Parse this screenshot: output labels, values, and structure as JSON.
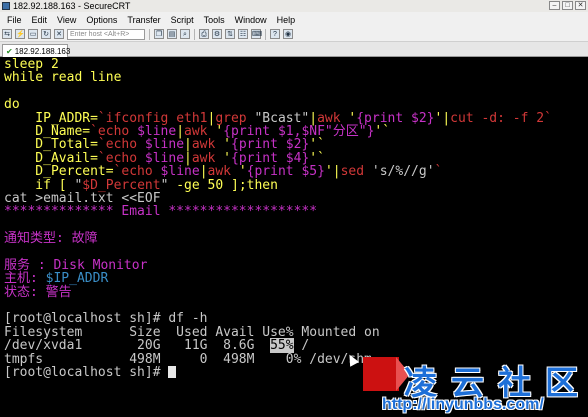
{
  "window": {
    "title": "182.92.188.163 - SecureCRT",
    "controls": [
      "–",
      "□",
      "✕"
    ]
  },
  "menu": [
    "File",
    "Edit",
    "View",
    "Options",
    "Transfer",
    "Script",
    "Tools",
    "Window",
    "Help"
  ],
  "toolbar": {
    "host_placeholder": "Enter host <Alt+R>"
  },
  "tab": {
    "label": "182.92.188.163"
  },
  "terminal": {
    "lines": [
      [
        {
          "t": "sleep 2",
          "c": "y"
        }
      ],
      [
        {
          "t": "while read line",
          "c": "y"
        }
      ],
      [
        {
          "t": "",
          "c": "y"
        }
      ],
      [
        {
          "t": "do",
          "c": "y"
        }
      ],
      [
        {
          "t": "    IP_ADDR=",
          "c": "y"
        },
        {
          "t": "`",
          "c": "r"
        },
        {
          "t": "ifconfig eth1",
          "c": "r"
        },
        {
          "t": "|",
          "c": "y"
        },
        {
          "t": "grep ",
          "c": "r"
        },
        {
          "t": "\"Bcast\"",
          "c": "w"
        },
        {
          "t": "|",
          "c": "y"
        },
        {
          "t": "awk ",
          "c": "r"
        },
        {
          "t": "'",
          "c": "y"
        },
        {
          "t": "{print $2}",
          "c": "m"
        },
        {
          "t": "'",
          "c": "y"
        },
        {
          "t": "|",
          "c": "y"
        },
        {
          "t": "cut -d: -f 2`",
          "c": "r"
        }
      ],
      [
        {
          "t": "    D_Name=",
          "c": "y"
        },
        {
          "t": "`",
          "c": "r"
        },
        {
          "t": "echo ",
          "c": "r"
        },
        {
          "t": "$line",
          "c": "m"
        },
        {
          "t": "|",
          "c": "y"
        },
        {
          "t": "awk ",
          "c": "r"
        },
        {
          "t": "'",
          "c": "y"
        },
        {
          "t": "{print $1,$NF\"分区\"}",
          "c": "m"
        },
        {
          "t": "'`",
          "c": "y"
        }
      ],
      [
        {
          "t": "    D_Total=",
          "c": "y"
        },
        {
          "t": "`",
          "c": "r"
        },
        {
          "t": "echo ",
          "c": "r"
        },
        {
          "t": "$line",
          "c": "m"
        },
        {
          "t": "|",
          "c": "y"
        },
        {
          "t": "awk ",
          "c": "r"
        },
        {
          "t": "'",
          "c": "y"
        },
        {
          "t": "{print $2}",
          "c": "m"
        },
        {
          "t": "'`",
          "c": "y"
        }
      ],
      [
        {
          "t": "    D_Avail=",
          "c": "y"
        },
        {
          "t": "`",
          "c": "r"
        },
        {
          "t": "echo ",
          "c": "r"
        },
        {
          "t": "$line",
          "c": "m"
        },
        {
          "t": "|",
          "c": "y"
        },
        {
          "t": "awk ",
          "c": "r"
        },
        {
          "t": "'",
          "c": "y"
        },
        {
          "t": "{print $4}",
          "c": "m"
        },
        {
          "t": "'`",
          "c": "y"
        }
      ],
      [
        {
          "t": "    D_Percent=",
          "c": "y"
        },
        {
          "t": "`",
          "c": "r"
        },
        {
          "t": "echo ",
          "c": "r"
        },
        {
          "t": "$line",
          "c": "m"
        },
        {
          "t": "|",
          "c": "y"
        },
        {
          "t": "awk ",
          "c": "r"
        },
        {
          "t": "'",
          "c": "y"
        },
        {
          "t": "{print $5}",
          "c": "m"
        },
        {
          "t": "'",
          "c": "y"
        },
        {
          "t": "|",
          "c": "y"
        },
        {
          "t": "sed ",
          "c": "r"
        },
        {
          "t": "'s/%//g'",
          "c": "w"
        },
        {
          "t": "`",
          "c": "r"
        }
      ],
      [
        {
          "t": "    if [ ",
          "c": "y"
        },
        {
          "t": "\"",
          "c": "w"
        },
        {
          "t": "$D_Percent",
          "c": "r"
        },
        {
          "t": "\"",
          "c": "w"
        },
        {
          "t": " -ge 50 ];then",
          "c": "y"
        }
      ],
      [
        {
          "t": "cat >email.txt <<EOF",
          "c": "w"
        }
      ],
      [
        {
          "t": "************** Email *******************",
          "c": "m"
        }
      ],
      [
        {
          "t": "",
          "c": "m"
        }
      ],
      [
        {
          "t": "通知类型: 故障",
          "c": "m"
        }
      ],
      [
        {
          "t": "",
          "c": "m"
        }
      ],
      [
        {
          "t": "服务 : Disk Monitor",
          "c": "m"
        }
      ],
      [
        {
          "t": "主机: ",
          "c": "m"
        },
        {
          "t": "$IP_ADDR",
          "c": "c"
        }
      ],
      [
        {
          "t": "状态: 警告",
          "c": "m"
        }
      ],
      [
        {
          "t": "",
          "c": "w"
        }
      ],
      [
        {
          "t": "[root@localhost sh]# df -h",
          "c": "w"
        }
      ],
      [
        {
          "t": "Filesystem      Size  Used Avail Use% Mounted on",
          "c": "w"
        }
      ],
      [
        {
          "t": "/dev/xvda1       20G   11G  8.6G  ",
          "c": "w"
        },
        {
          "t": "55%",
          "c": "hl"
        },
        {
          "t": " /",
          "c": "w"
        }
      ],
      [
        {
          "t": "tmpfs           498M     0  498M    0% /dev/shm",
          "c": "w"
        }
      ],
      [
        {
          "t": "[root@localhost sh]# ",
          "c": "w"
        }
      ]
    ]
  },
  "watermark": {
    "cn": "凌云社区",
    "url": "http://linyunbbs.com/"
  }
}
